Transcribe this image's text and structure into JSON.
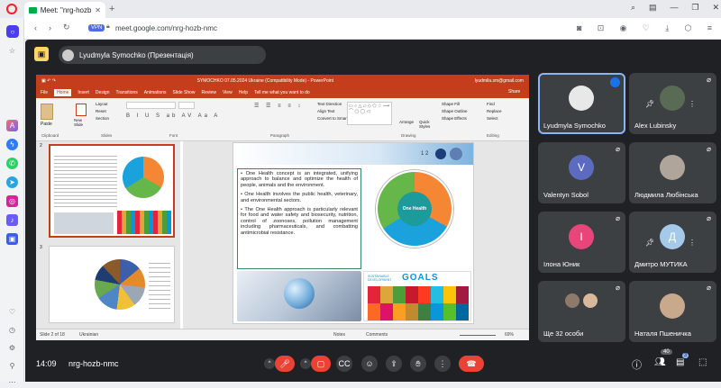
{
  "browser": {
    "tab_title": "Meet: \"nrg-hozb-...",
    "new_tab": "+",
    "url": "meet.google.com/nrg-hozb-nmc",
    "vpn": "VPN"
  },
  "meet": {
    "presenter_label": "Lyudmyla Symochko (Презентація)",
    "time": "14:09",
    "meeting_code": "nrg-hozb-nmc",
    "participant_count": "40",
    "chat_badge": "3"
  },
  "powerpoint": {
    "title": "SYMOCHKO 07.05.2024 Ukraine (Compatibility Mode) - PowerPoint",
    "account": "lyudmila.sm@gmail.com",
    "tabs": [
      "File",
      "Home",
      "Insert",
      "Design",
      "Transitions",
      "Animations",
      "Slide Show",
      "Review",
      "View",
      "Help",
      "Tell me what you want to do"
    ],
    "share": "Share",
    "groups": [
      "Clipboard",
      "Slides",
      "Font",
      "Paragraph",
      "Drawing",
      "Editing"
    ],
    "buttons": {
      "paste": "Paste",
      "new_slide": "New Slide",
      "layout": "Layout",
      "reset": "Reset",
      "section": "Section",
      "text_direction": "Text Direction",
      "align_text": "Align Text",
      "convert": "Convert to SmartArt",
      "arrange": "Arrange",
      "quick_styles": "Quick Styles",
      "shape_fill": "Shape Fill",
      "shape_outline": "Shape Outline",
      "shape_effects": "Shape Effects",
      "find": "Find",
      "replace": "Replace",
      "select": "Select"
    },
    "slide_numbers": [
      "2",
      "3"
    ],
    "status_left": "Slide 2 of 18",
    "status_lang": "Ukrainian",
    "status_notes": "Notes",
    "status_comments": "Comments",
    "zoom": "69%"
  },
  "slide": {
    "page_numbers": "1   2",
    "bullets": [
      "One Health concept is an integrated, unifying approach to balance and optimize the health of people, animals and the environment.",
      "One Health involves the public health, veterinary, and environmental sectors.",
      "The One Health approach is particularly relevant for food and water safety and biosecurity, nutrition, control of zoonoses, pollution management including pharmaceuticals, and combatting antimicrobial resistance."
    ],
    "center_label": "One Health",
    "goals_title": "GOALS",
    "goals_sub": "SUSTAINABLE DEVELOPMENT"
  },
  "participants": [
    {
      "name": "Lyudmyla Symochko",
      "type": "photo",
      "color": "#e8e8e8",
      "active": true
    },
    {
      "name": "Alex Lubinsky",
      "type": "photo",
      "color": "#5a6b55",
      "active": false
    },
    {
      "name": "Valentyn Sobol",
      "type": "letter",
      "letter": "V",
      "color": "#5c6bc0",
      "active": false
    },
    {
      "name": "Людмила Любінська",
      "type": "photo",
      "color": "#b0a59a",
      "active": false
    },
    {
      "name": "Ілона Юник",
      "type": "letter",
      "letter": "I",
      "color": "#e8457a",
      "active": false
    },
    {
      "name": "Дмитро МУТИКА",
      "type": "letter",
      "letter": "Д",
      "color": "#a5c9e8",
      "active": false
    },
    {
      "name": "Ще 32 особи",
      "type": "group",
      "color": "#8d7a6a",
      "active": false
    },
    {
      "name": "Наталя Пшеничка",
      "type": "photo",
      "color": "#c9a98c",
      "active": false
    }
  ],
  "colors": {
    "accent": "#8ab4f8",
    "red": "#ea4335",
    "ppt_red": "#c43e1c",
    "sdg_blue": "#0a97d9"
  }
}
